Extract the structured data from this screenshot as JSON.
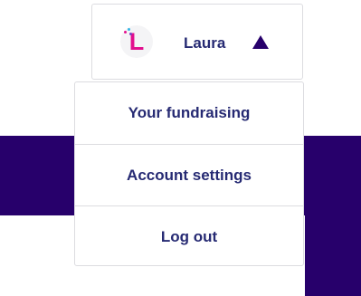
{
  "user": {
    "name": "Laura",
    "avatar_letter": "L",
    "avatar_icon": "brand-letter-l-icon",
    "caret_icon": "caret-up-icon"
  },
  "menu": {
    "items": [
      {
        "label": "Your fundraising"
      },
      {
        "label": "Account settings"
      },
      {
        "label": "Log out"
      }
    ]
  },
  "colors": {
    "banner": "#27006b",
    "text": "#262a73",
    "avatar_accent": "#e20f8e",
    "border": "#dcdce0",
    "background": "#ffffff"
  }
}
